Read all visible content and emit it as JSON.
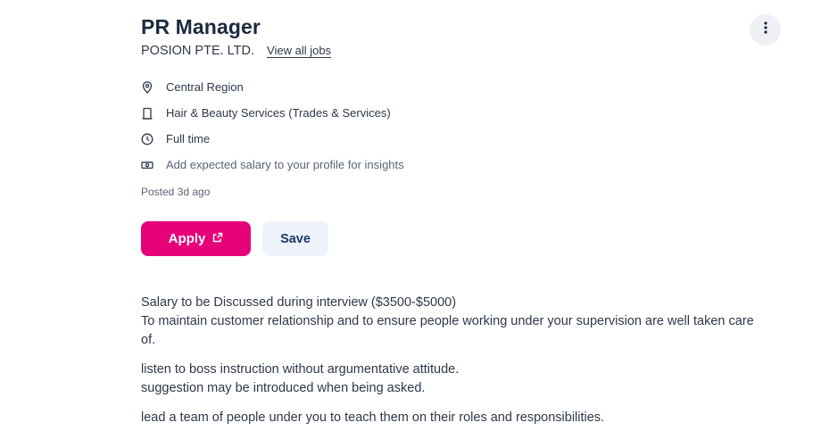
{
  "job": {
    "title": "PR Manager",
    "company": "POSION PTE. LTD.",
    "view_all_jobs": "View all jobs"
  },
  "meta": {
    "location": "Central Region",
    "classification": "Hair & Beauty Services (Trades & Services)",
    "work_type": "Full time",
    "salary_prompt": "Add expected salary to your profile for insights"
  },
  "posted": "Posted 3d ago",
  "actions": {
    "apply_label": "Apply",
    "save_label": "Save"
  },
  "description": {
    "p1_line1": "Salary to be Discussed during interview ($3500-$5000)",
    "p1_line2": "To maintain customer relationship and to ensure people working under your supervision are well taken care of.",
    "p2_line1": "listen to boss instruction without argumentative attitude.",
    "p2_line2": "suggestion may be introduced when being asked.",
    "p3_line1": "lead a team of people under you to teach them on their roles and responsibilities."
  },
  "icons": {
    "location": "map-pin-icon",
    "classification": "building-icon",
    "work_type": "clock-icon",
    "salary": "money-icon",
    "apply": "external-link-icon",
    "more": "more-vertical-icon"
  },
  "colors": {
    "accent": "#e60278",
    "save_bg": "#eef3fa",
    "text": "#2e3849"
  }
}
